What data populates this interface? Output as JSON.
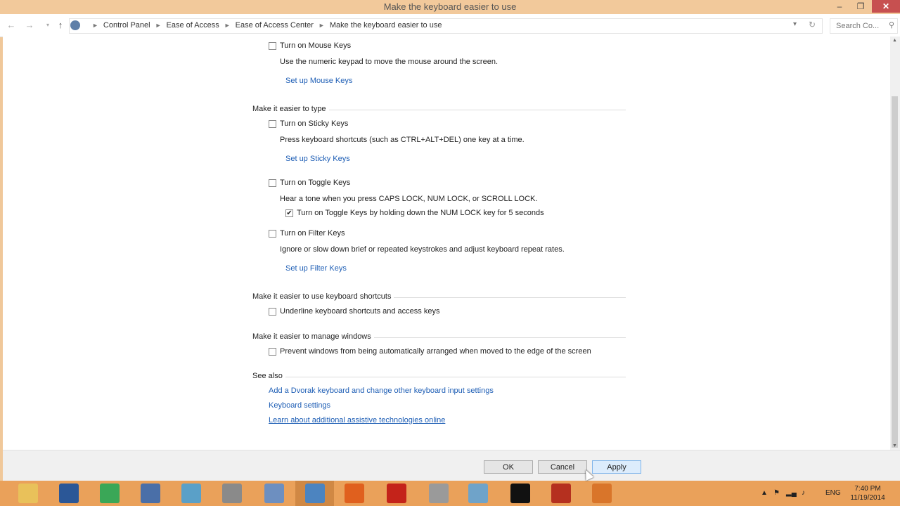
{
  "window": {
    "title": "Make the keyboard easier to use"
  },
  "address": {
    "crumbs": [
      "Control Panel",
      "Ease of Access",
      "Ease of Access Center",
      "Make the keyboard easier to use"
    ],
    "search_placeholder": "Search Co..."
  },
  "mouse_keys": {
    "checkbox_label": "Turn on Mouse Keys",
    "checked": false,
    "description": "Use the numeric keypad to move the mouse around the screen.",
    "setup_link": "Set up Mouse Keys"
  },
  "typing": {
    "heading": "Make it easier to type",
    "sticky": {
      "label": "Turn on Sticky Keys",
      "checked": false,
      "description": "Press keyboard shortcuts (such as CTRL+ALT+DEL) one key at a time.",
      "setup_link": "Set up Sticky Keys"
    },
    "toggle": {
      "label": "Turn on Toggle Keys",
      "checked": false,
      "description": "Hear a tone when you press CAPS LOCK, NUM LOCK, or SCROLL LOCK.",
      "sub_label": "Turn on Toggle Keys by holding down the NUM LOCK key for 5 seconds",
      "sub_checked": true,
      "sub_check_glyph": "✔"
    },
    "filter": {
      "label": "Turn on Filter Keys",
      "checked": false,
      "description": "Ignore or slow down brief or repeated keystrokes and adjust keyboard repeat rates.",
      "setup_link": "Set up Filter Keys"
    }
  },
  "shortcuts": {
    "heading": "Make it easier to use keyboard shortcuts",
    "label": "Underline keyboard shortcuts and access keys",
    "checked": false
  },
  "windows": {
    "heading": "Make it easier to manage windows",
    "label": "Prevent windows from being automatically arranged when moved to the edge of the screen",
    "checked": false
  },
  "see_also": {
    "heading": "See also",
    "links": [
      "Add a Dvorak keyboard and change other keyboard input settings",
      "Keyboard settings",
      "Learn about additional assistive technologies online"
    ]
  },
  "buttons": {
    "ok": "OK",
    "cancel": "Cancel",
    "apply": "Apply"
  },
  "taskbar": {
    "language": "ENG",
    "time": "7:40 PM",
    "date": "11/19/2014",
    "icons": [
      {
        "name": "file-explorer-icon",
        "color": "#e9c15a"
      },
      {
        "name": "word-icon",
        "color": "#2b5797"
      },
      {
        "name": "chrome-icon",
        "color": "#3aa757"
      },
      {
        "name": "wordpad-icon",
        "color": "#4a6fa8"
      },
      {
        "name": "photo-app-icon",
        "color": "#5aa0c8"
      },
      {
        "name": "checkers-app-icon",
        "color": "#8a8a8a"
      },
      {
        "name": "notepad-icon",
        "color": "#6d8fc0"
      },
      {
        "name": "control-panel-icon",
        "color": "#4c84c0"
      },
      {
        "name": "firefox-icon",
        "color": "#e0601e"
      },
      {
        "name": "pdf-reader-icon",
        "color": "#c4231a"
      },
      {
        "name": "camera-app-icon",
        "color": "#9a9a9a"
      },
      {
        "name": "paint-icon",
        "color": "#6fa3c9"
      },
      {
        "name": "runner-app-icon",
        "color": "#111111"
      },
      {
        "name": "app-icon-red",
        "color": "#b5301f"
      },
      {
        "name": "app-icon-orange",
        "color": "#d9752a"
      }
    ]
  },
  "colors": {
    "link": "#1e5eb5",
    "titlebar": "#f2c99b",
    "taskbar": "#eaa15a"
  }
}
